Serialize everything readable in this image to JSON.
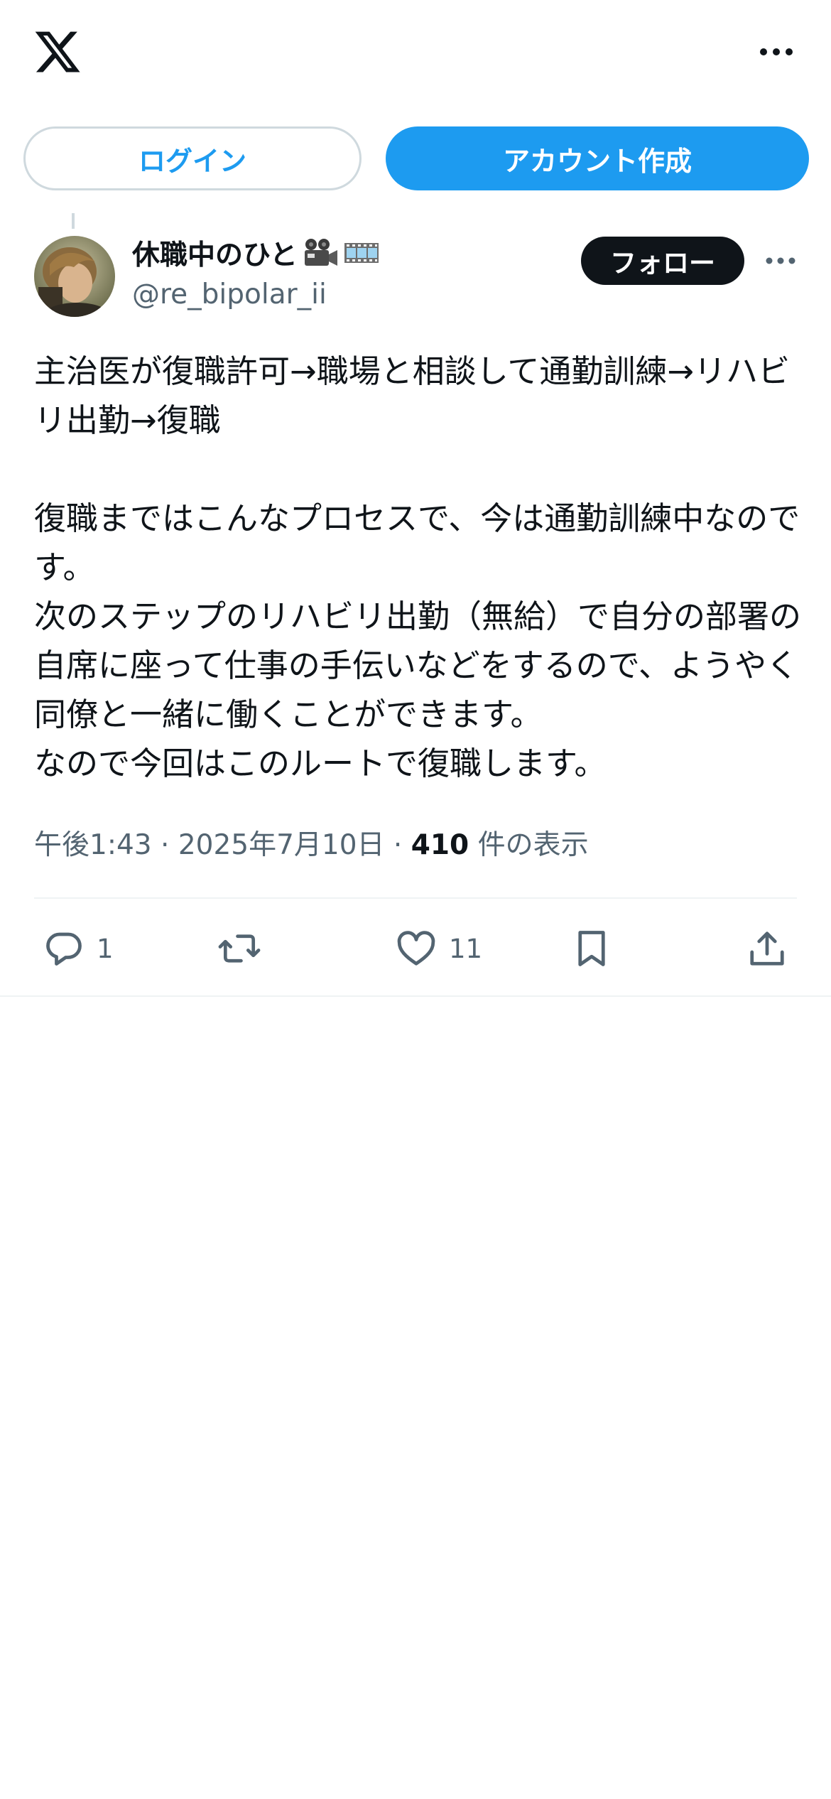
{
  "header": {
    "logo_icon": "x-logo-icon",
    "more_icon": "more-horizontal-icon"
  },
  "auth": {
    "login_label": "ログイン",
    "signup_label": "アカウント作成"
  },
  "tweet": {
    "author": {
      "display_name": "休職中のひと",
      "name_emojis": [
        "movie-camera-icon",
        "film-frames-icon"
      ],
      "handle": "@re_bipolar_ii",
      "follow_label": "フォロー"
    },
    "text": "主治医が復職許可→職場と相談して通勤訓練→リハビリ出勤→復職\n\n復職まではこんなプロセスで、今は通勤訓練中なのです。\n次のステップのリハビリ出勤（無給）で自分の部署の自席に座って仕事の手伝いなどをするので、ようやく同僚と一緒に働くことができます。\nなので今回はこのルートで復職します。",
    "time": "午後1:43",
    "separator": "·",
    "date": "2025年7月10日",
    "views_count": "410",
    "views_label": "件の表示",
    "actions": {
      "reply_count": "1",
      "like_count": "11"
    }
  },
  "colors": {
    "accent": "#1d9bf0",
    "text_primary": "#0f1419",
    "text_secondary": "#536471",
    "border": "#cfd9de"
  }
}
